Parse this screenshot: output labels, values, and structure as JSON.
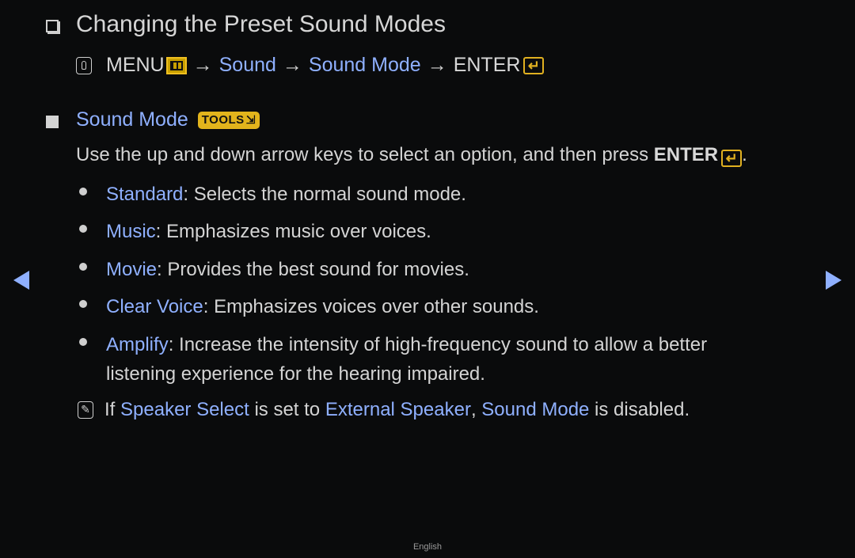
{
  "title": "Changing the Preset Sound Modes",
  "path": {
    "menu": "MENU",
    "arrow": "→",
    "sound": "Sound",
    "sound_mode": "Sound Mode",
    "enter": "ENTER",
    "enter_glyph": "↵"
  },
  "section": {
    "title": "Sound Mode",
    "tools_badge": "TOOLS",
    "tools_glyph": "⇲"
  },
  "instruction": {
    "text": "Use the up and down arrow keys to select an option, and then press ",
    "enter": "ENTER",
    "enter_glyph": "↵",
    "end": "."
  },
  "options": [
    {
      "name": "Standard",
      "desc": ": Selects the normal sound mode."
    },
    {
      "name": "Music",
      "desc": ": Emphasizes music over voices."
    },
    {
      "name": "Movie",
      "desc": ": Provides the best sound for movies."
    },
    {
      "name": "Clear Voice",
      "desc": ": Emphasizes voices over other sounds."
    },
    {
      "name": "Amplify",
      "desc": ": Increase the intensity of high-frequency sound to allow a better listening experience for the hearing impaired."
    }
  ],
  "note": {
    "glyph": "✎",
    "if": "If ",
    "speaker_select": "Speaker Select",
    "is_set_to": " is set to ",
    "external_speaker": "External Speaker",
    "comma": ", ",
    "sound_mode": "Sound Mode",
    "is_disabled": " is disabled."
  },
  "nav": {
    "prev": "previous page",
    "next": "next page"
  },
  "footer": {
    "language": "English"
  },
  "colors": {
    "background": "#0a0b0c",
    "link": "#8fb0ff",
    "accent": "#e2b41c",
    "text": "#d4d4d4"
  }
}
